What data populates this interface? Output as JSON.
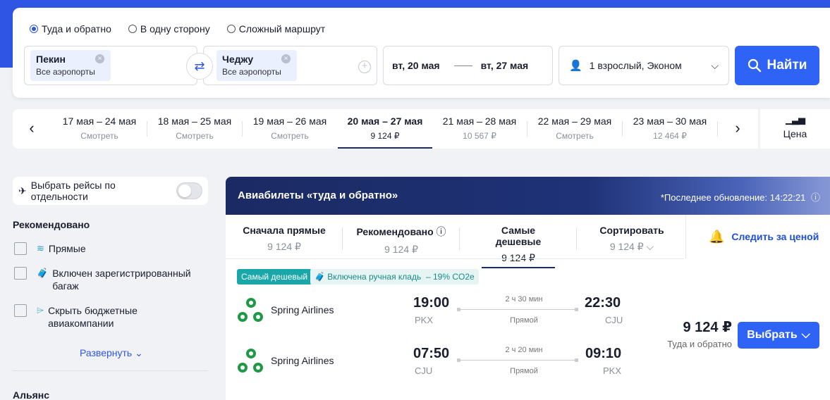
{
  "search": {
    "trip_types": [
      {
        "label": "Туда и обратно",
        "active": true
      },
      {
        "label": "В одну сторону",
        "active": false
      },
      {
        "label": "Сложный маршрут",
        "active": false
      }
    ],
    "from": {
      "city": "Пекин",
      "airports": "Все аэропорты"
    },
    "to": {
      "city": "Чеджу",
      "airports": "Все аэропорты"
    },
    "date_from": "вт, 20 мая",
    "date_to": "вт, 27 мая",
    "passengers": "1 взрослый, Эконом",
    "find_label": "Найти"
  },
  "date_strip": [
    {
      "range": "17 мая – 24 мая",
      "sub": "Смотреть",
      "active": false
    },
    {
      "range": "18 мая – 25 мая",
      "sub": "Смотреть",
      "active": false
    },
    {
      "range": "19 мая – 26 мая",
      "sub": "Смотреть",
      "active": false
    },
    {
      "range": "20 мая – 27 мая",
      "sub": "9 124 ₽",
      "active": true
    },
    {
      "range": "21 мая – 28 мая",
      "sub": "10 567 ₽",
      "active": false
    },
    {
      "range": "22 мая – 29 мая",
      "sub": "Смотреть",
      "active": false
    },
    {
      "range": "23 мая – 30 мая",
      "sub": "12 464 ₽",
      "active": false
    }
  ],
  "price_toggle_label": "Цена",
  "filters": {
    "select_separately": "Выбрать рейсы по отдельности",
    "recommended_title": "Рекомендовано",
    "items": [
      {
        "label": "Прямые"
      },
      {
        "label_line1": "Включен зарегистрированный",
        "label_line2": "багаж"
      },
      {
        "label_line1": "Скрыть бюджетные",
        "label_line2": "авиакомпании"
      }
    ],
    "expand": "Развернуть",
    "alliance_title": "Альянс"
  },
  "results": {
    "title": "Авиабилеты «туда и обратно»",
    "updated": "*Последнее обновление: 14:22:21",
    "sort_tabs": [
      {
        "label": "Сначала прямые",
        "price": "9 124 ₽",
        "active": false
      },
      {
        "label": "Рекомендовано",
        "price": "9 124 ₽",
        "active": false
      },
      {
        "label": "Самые дешевые",
        "price": "9 124 ₽",
        "active": true
      },
      {
        "label": "Сортировать",
        "price": "9 124 ₽",
        "active": false
      }
    ],
    "track_price": "Следить за ценой",
    "offer": {
      "badge_cheapest": "Самый дешевый",
      "badge_bag": "Включена ручная кладь",
      "badge_co2": "– 19% CO2e",
      "legs": [
        {
          "airline": "Spring Airlines",
          "dep_time": "19:00",
          "dep_code": "PKX",
          "duration": "2 ч 30 мин",
          "type": "Прямой",
          "arr_time": "22:30",
          "arr_code": "CJU"
        },
        {
          "airline": "Spring Airlines",
          "dep_time": "07:50",
          "dep_code": "CJU",
          "duration": "2 ч 20 мин",
          "type": "Прямой",
          "arr_time": "09:10",
          "arr_code": "PKX"
        }
      ],
      "price": "9 124 ₽",
      "price_sub": "Туда и обратно",
      "select_label": "Выбрать"
    }
  },
  "colors": {
    "brand": "#2f55e4",
    "button": "#2f63f5",
    "badge_teal": "#1aa7a9",
    "logo_green": "#1e9a46"
  }
}
